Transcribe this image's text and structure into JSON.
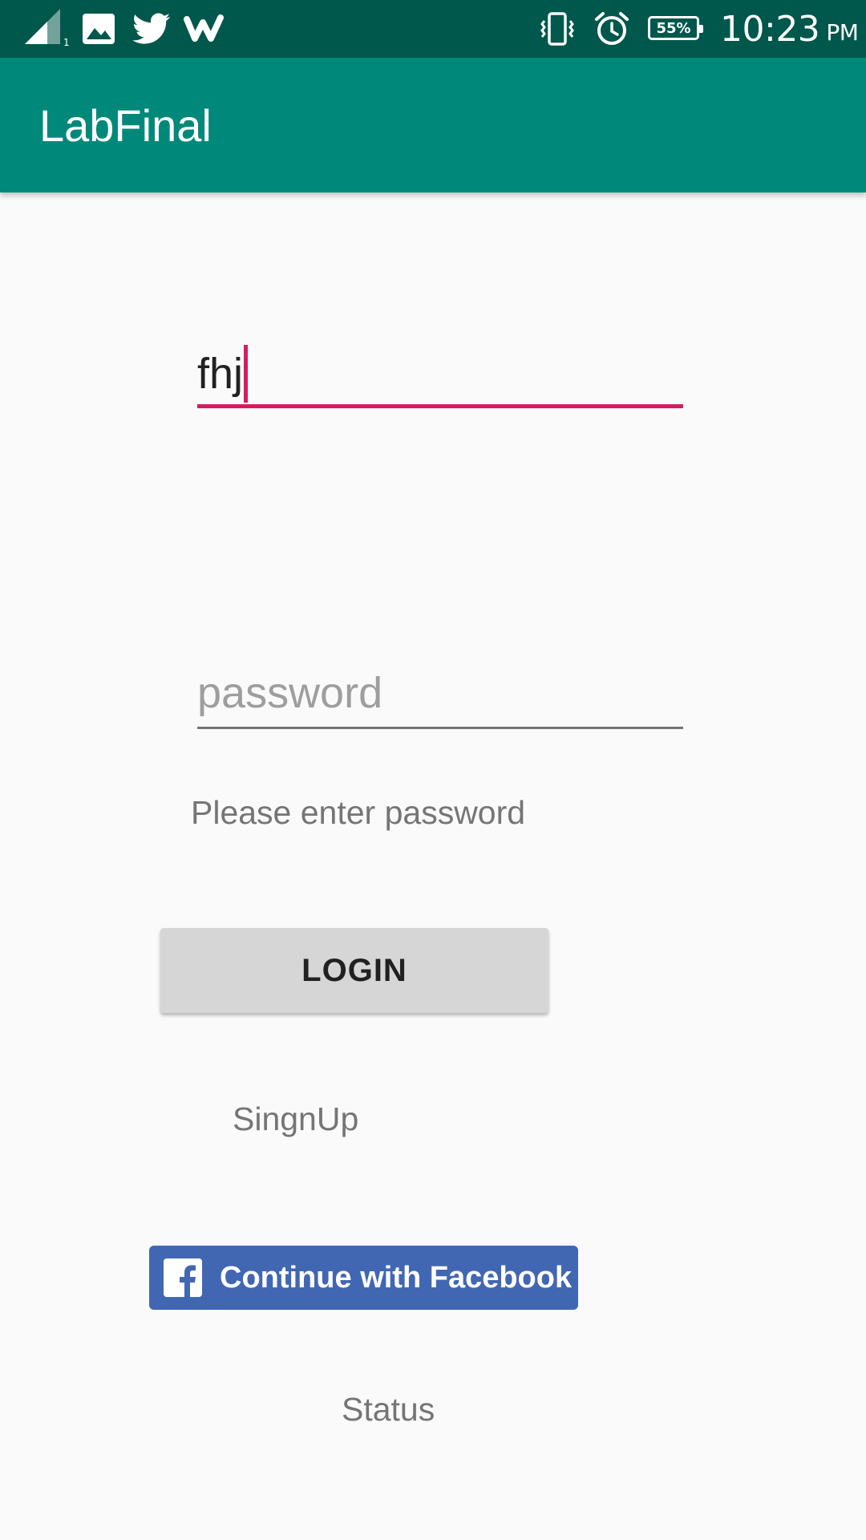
{
  "status_bar": {
    "time": "10:23",
    "ampm": "PM",
    "battery": "55%",
    "icons": [
      "signal-icon",
      "gallery-icon",
      "twitter-icon",
      "wattpad-icon",
      "vibrate-icon",
      "alarm-icon",
      "battery-icon"
    ]
  },
  "app_bar": {
    "title": "LabFinal",
    "color": "#00897b"
  },
  "form": {
    "username_value": "fhj",
    "password_placeholder": "password",
    "helper": "Please enter password",
    "login_label": "LOGIN",
    "signup_label": "SingnUp",
    "facebook_label": "Continue with Facebook",
    "status_label": "Status"
  },
  "colors": {
    "status_bar": "#00574b",
    "accent": "#d81b60",
    "facebook": "#4267b2"
  }
}
